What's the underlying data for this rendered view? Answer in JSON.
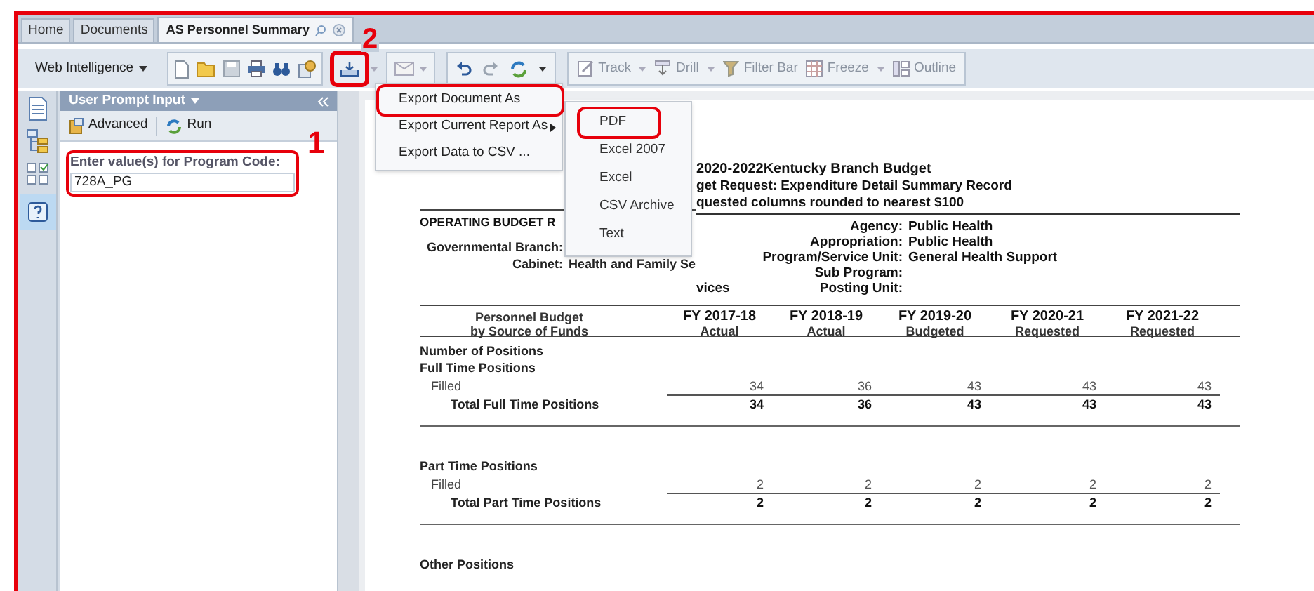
{
  "tabs": [
    {
      "label": "Home",
      "selected": false
    },
    {
      "label": "Documents",
      "selected": false
    },
    {
      "label": "AS Personnel Summary",
      "selected": true
    }
  ],
  "toolbar": {
    "app_menu": "Web Intelligence",
    "export_marked": true,
    "buttons": [
      {
        "label": "Track"
      },
      {
        "label": "Drill"
      },
      {
        "label": "Filter Bar"
      },
      {
        "label": "Freeze"
      },
      {
        "label": "Outline"
      }
    ]
  },
  "prompt_panel": {
    "title": "User Prompt Input",
    "actions": [
      "Advanced",
      "Run"
    ],
    "prompt_label": "Enter value(s) for Program Code:",
    "value": "728A_PG",
    "marked": true
  },
  "export_menu": {
    "items": [
      {
        "label": "Export Document As",
        "has_submenu": false,
        "marked": true
      },
      {
        "label": "Export Current Report As",
        "has_submenu": true,
        "marked": false
      },
      {
        "label": "Export Data to CSV ...",
        "has_submenu": false,
        "marked": false
      }
    ],
    "submenu": [
      {
        "label": "PDF",
        "marked": true
      },
      {
        "label": "Excel 2007",
        "marked": false
      },
      {
        "label": "Excel",
        "marked": false
      },
      {
        "label": "CSV Archive",
        "marked": false
      },
      {
        "label": "Text",
        "marked": false
      }
    ]
  },
  "annotations": [
    {
      "label": "1"
    },
    {
      "label": "2"
    }
  ],
  "report": {
    "title_lines": [
      "2020-2022Kentucky Branch Budget",
      "get Request: Expenditure Detail Summary Record",
      "quested columns rounded to nearest $100"
    ],
    "section_title": "OPERATING BUDGET R",
    "left_fields": [
      {
        "label": "Governmental Branch:"
      },
      {
        "label": "Cabinet:",
        "value": "Health and Family Se"
      }
    ],
    "wrap_text": "vices",
    "right_fields": [
      {
        "label": "Agency:",
        "value": "Public Health"
      },
      {
        "label": "Appropriation:",
        "value": "Public Health"
      },
      {
        "label": "Program/Service Unit:",
        "value": "General Health Support"
      },
      {
        "label": "Sub Program:"
      },
      {
        "label": "Posting Unit:"
      }
    ],
    "table": {
      "header": [
        "Personnel Budget",
        "by Source of Funds"
      ],
      "columns": [
        {
          "year": "FY 2017-18",
          "type": "Actual"
        },
        {
          "year": "FY 2018-19",
          "type": "Actual"
        },
        {
          "year": "FY 2019-20",
          "type": "Budgeted"
        },
        {
          "year": "FY 2020-21",
          "type": "Requested"
        },
        {
          "year": "FY 2021-22",
          "type": "Requested"
        }
      ],
      "rows": [
        {
          "kind": "group",
          "label": "Number of Positions"
        },
        {
          "kind": "group",
          "label": "Full Time Positions"
        },
        {
          "kind": "line",
          "label": "Filled",
          "values": [
            "34",
            "36",
            "43",
            "43",
            "43"
          ]
        },
        {
          "kind": "total",
          "label": "Total Full Time Positions",
          "values": [
            "34",
            "36",
            "43",
            "43",
            "43"
          ]
        },
        {
          "kind": "group",
          "label": "Part Time Positions"
        },
        {
          "kind": "line",
          "label": "Filled",
          "values": [
            "2",
            "2",
            "2",
            "2",
            "2"
          ]
        },
        {
          "kind": "total",
          "label": "Total Part Time Positions",
          "values": [
            "2",
            "2",
            "2",
            "2",
            "2"
          ]
        },
        {
          "kind": "group",
          "label": "Other Positions"
        }
      ]
    }
  }
}
